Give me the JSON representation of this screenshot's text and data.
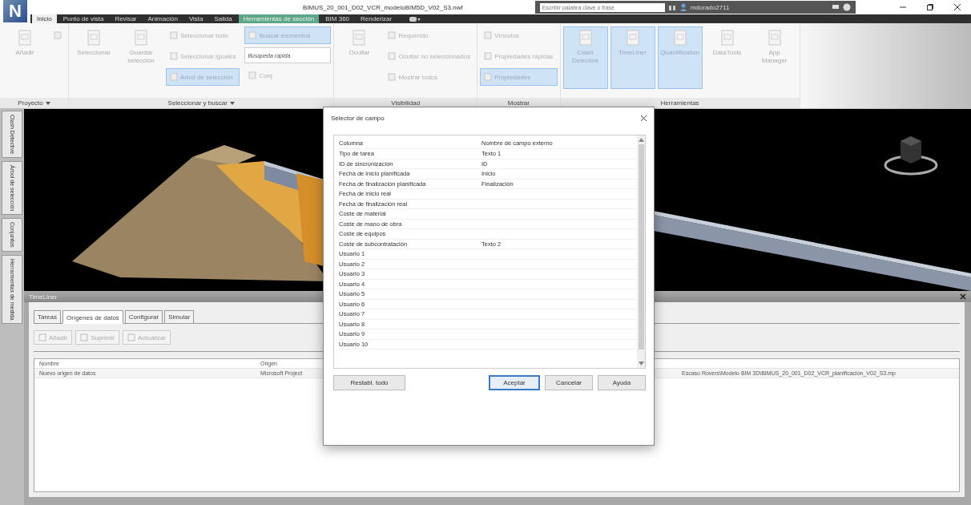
{
  "app": {
    "logo": "N",
    "title": "BIMUS_20_001_D02_VCR_modeloBIM5D_V02_S3.nwf",
    "search": {
      "placeholder": "Escribir palabra clave o frase"
    },
    "user": "mdorado2711"
  },
  "ribbon_tabs": [
    {
      "label": "Inicio",
      "selected": true,
      "contextual": false
    },
    {
      "label": "Punto de vista",
      "selected": false,
      "contextual": false
    },
    {
      "label": "Revisar",
      "selected": false,
      "contextual": false
    },
    {
      "label": "Animación",
      "selected": false,
      "contextual": false
    },
    {
      "label": "Vista",
      "selected": false,
      "contextual": false
    },
    {
      "label": "Salida",
      "selected": false,
      "contextual": false
    },
    {
      "label": "Herramientas de sección",
      "selected": false,
      "contextual": true
    },
    {
      "label": "BIM 360",
      "selected": false,
      "contextual": false
    },
    {
      "label": "Renderizar",
      "selected": false,
      "contextual": false
    }
  ],
  "ribbon_groups": [
    {
      "label": "Proyecto",
      "menu": true,
      "items": [
        {
          "kind": "large",
          "label": "Añadir",
          "active": false
        },
        {
          "kind": "small",
          "active": false
        }
      ]
    },
    {
      "label": "Seleccionar y buscar",
      "menu": true,
      "items": [
        {
          "kind": "large",
          "label": "Seleccionar",
          "active": false
        },
        {
          "kind": "large",
          "label": "Guardar selección",
          "active": false
        },
        {
          "kind": "small",
          "label": "Seleccionar todo",
          "active": false
        },
        {
          "kind": "small",
          "label": "Seleccionar iguales",
          "active": false
        },
        {
          "kind": "small",
          "label": "Árbol de selección",
          "active": true
        },
        {
          "kind": "small",
          "label": "Buscar elementos",
          "active": true
        },
        {
          "kind": "field",
          "placeholder": "Búsqueda rápida"
        },
        {
          "kind": "small",
          "label": "Conj",
          "active": false
        }
      ]
    },
    {
      "label": "Visibilidad",
      "menu": false,
      "items": [
        {
          "kind": "large",
          "label": "Ocultar",
          "active": false
        },
        {
          "kind": "small",
          "label": "Requerido",
          "active": false
        },
        {
          "kind": "small",
          "label": "Ocultar no seleccionados",
          "active": false
        },
        {
          "kind": "small",
          "label": "Mostrar todos",
          "active": false
        }
      ]
    },
    {
      "label": "Mostrar",
      "menu": false,
      "items": [
        {
          "kind": "small",
          "label": "Vínculos",
          "active": false
        },
        {
          "kind": "small",
          "label": "Propiedades rápidas",
          "active": false
        },
        {
          "kind": "small",
          "label": "Propiedades",
          "active": true
        }
      ]
    },
    {
      "label": "Herramientas",
      "menu": false,
      "items": [
        {
          "kind": "large",
          "label": "Clash Detective",
          "active": true
        },
        {
          "kind": "large",
          "label": "TimeLiner",
          "active": true
        },
        {
          "kind": "large",
          "label": "Quantification",
          "active": true
        },
        {
          "kind": "large",
          "label": "DataTools",
          "active": false
        },
        {
          "kind": "large",
          "label": "App Manager",
          "active": false
        }
      ]
    }
  ],
  "side_tabs": [
    "Clash Detective",
    "Árbol de selección",
    "Conjuntos",
    "Herramientas de medida"
  ],
  "timeliner": {
    "title": "TimeLiner",
    "tabs": [
      {
        "label": "Tareas",
        "selected": false
      },
      {
        "label": "Orígenes de datos",
        "selected": true
      },
      {
        "label": "Configurar",
        "selected": false
      },
      {
        "label": "Simular",
        "selected": false
      }
    ],
    "buttons": [
      {
        "label": "Añadir",
        "disabled": true
      },
      {
        "label": "Suprimir",
        "disabled": true
      },
      {
        "label": "Actualizar",
        "disabled": true
      }
    ],
    "columns": [
      "Nombre",
      "Origen"
    ],
    "rows": [
      {
        "cells": [
          "Nuevo origen de datos",
          "Microsoft Project"
        ],
        "column_3": "Escaso Rovers\\Modelo BIM 3D\\BIMUS_20_001_D02_VCR_planificación_V02_S3.mp"
      }
    ]
  },
  "dialog": {
    "title": "Selector de campo",
    "columns": [
      "Columna",
      "Nombre de campo externo"
    ],
    "rows": [
      {
        "column": "Tipo de tarea",
        "external": "Texto 1"
      },
      {
        "column": "ID de sincronización",
        "external": "ID"
      },
      {
        "column": "Fecha de inicio planificada",
        "external": "Inicio"
      },
      {
        "column": "Fecha de finalización planificada",
        "external": "Finalización"
      },
      {
        "column": "Fecha de inicio real"
      },
      {
        "column": "Fecha de finalización real"
      },
      {
        "column": "Coste de material"
      },
      {
        "column": "Coste de mano de obra"
      },
      {
        "column": "Coste de equipos"
      },
      {
        "column": "Coste de subcontratación",
        "external": "Texto 2"
      },
      {
        "column": "Usuario 1"
      },
      {
        "column": "Usuario 2"
      },
      {
        "column": "Usuario 3"
      },
      {
        "column": "Usuario 4"
      },
      {
        "column": "Usuario 5"
      },
      {
        "column": "Usuario 6"
      },
      {
        "column": "Usuario 7"
      },
      {
        "column": "Usuario 8"
      },
      {
        "column": "Usuario 9"
      },
      {
        "column": "Usuario 10"
      }
    ],
    "buttons": [
      {
        "label": "Restabl. todo",
        "default": false
      },
      {
        "label": "Aceptar",
        "default": true
      },
      {
        "label": "Cancelar",
        "default": false
      },
      {
        "label": "Ayuda",
        "default": false
      }
    ]
  }
}
